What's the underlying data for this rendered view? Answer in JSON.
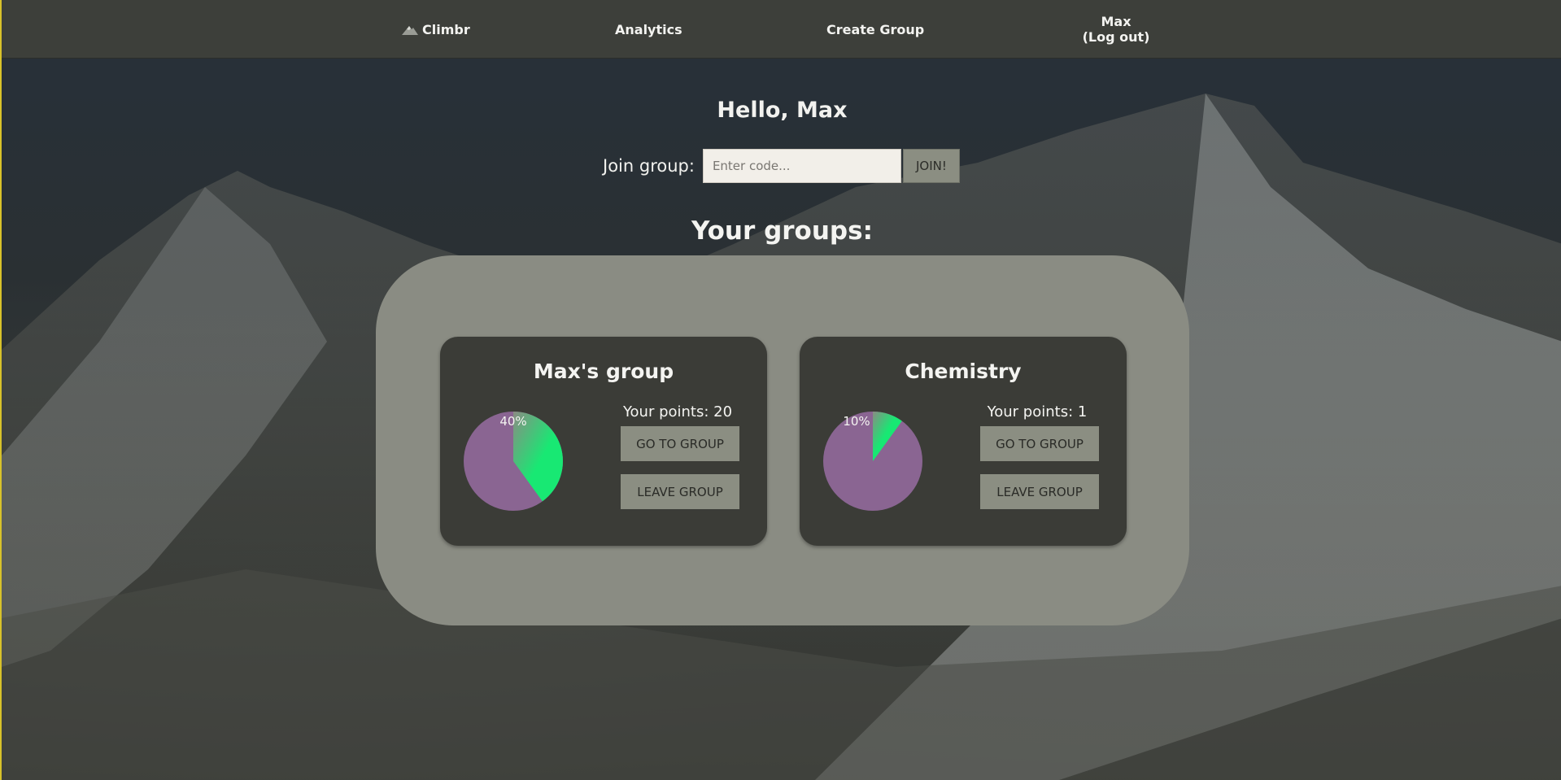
{
  "nav": {
    "logo_label": "Climbr",
    "analytics_label": "Analytics",
    "create_group_label": "Create Group",
    "user_name": "Max",
    "logout_label": "(Log out)"
  },
  "greeting": "Hello, Max",
  "join": {
    "label": "Join group:",
    "placeholder": "Enter code...",
    "button_label": "JOIN!"
  },
  "groups_heading": "Your groups:",
  "groups": [
    {
      "name": "Max's group",
      "progress_label": "40%",
      "progress_fraction": 0.4,
      "points_text": "Your points: 20",
      "go_label": "GO TO GROUP",
      "leave_label": "LEAVE GROUP"
    },
    {
      "name": "Chemistry",
      "progress_label": "10%",
      "progress_fraction": 0.1,
      "points_text": "Your points: 1",
      "go_label": "GO TO GROUP",
      "leave_label": "LEAVE GROUP"
    }
  ],
  "colors": {
    "pie_base": "#8a6592",
    "pie_fill": "#18e873",
    "navbar": "#3d3f3a",
    "panel": "#8a8c83",
    "card": "#3b3c37",
    "button": "#8b8e82"
  },
  "icons": {
    "logo": "mountain-icon"
  }
}
